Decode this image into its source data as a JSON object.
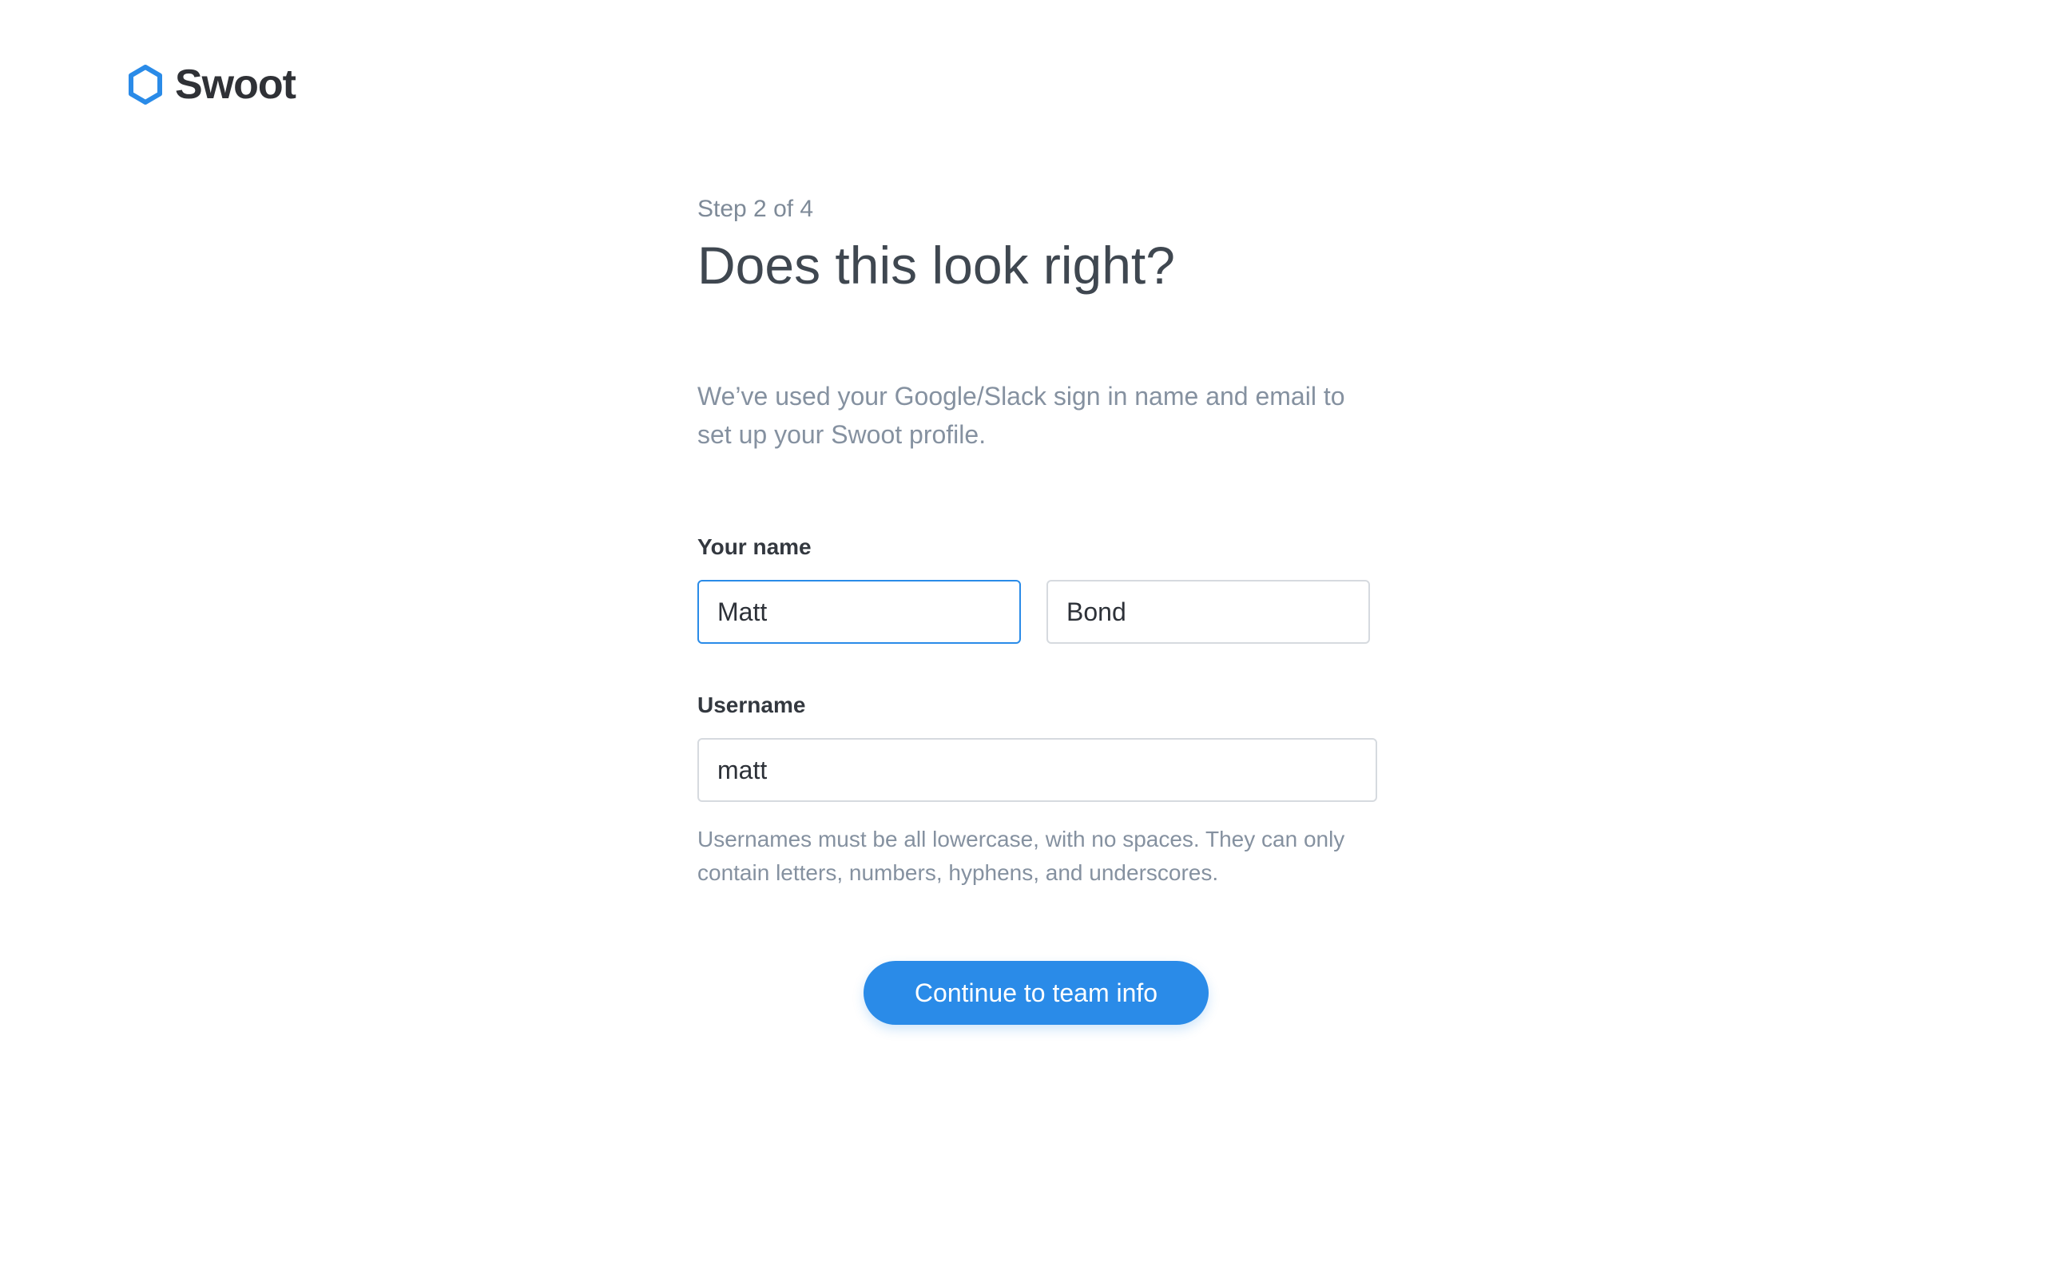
{
  "brand": {
    "name": "Swoot",
    "icon": "hexagon-logo-icon",
    "color": "#2a8be8"
  },
  "onboarding": {
    "step": "Step 2 of 4",
    "title": "Does this look right?",
    "description": "We’ve used your Google/Slack sign in name and email to set up your Swoot profile."
  },
  "form": {
    "name_label": "Your name",
    "first_name_value": "Matt",
    "last_name_value": "Bond",
    "username_label": "Username",
    "username_value": "matt",
    "username_hint": "Usernames must be all lowercase, with no spaces. They can only contain letters, numbers, hyphens, and underscores."
  },
  "actions": {
    "continue_label": "Continue to team info"
  },
  "colors": {
    "accent": "#2a8be8",
    "heading": "#3f4750",
    "muted": "#8591a0"
  }
}
